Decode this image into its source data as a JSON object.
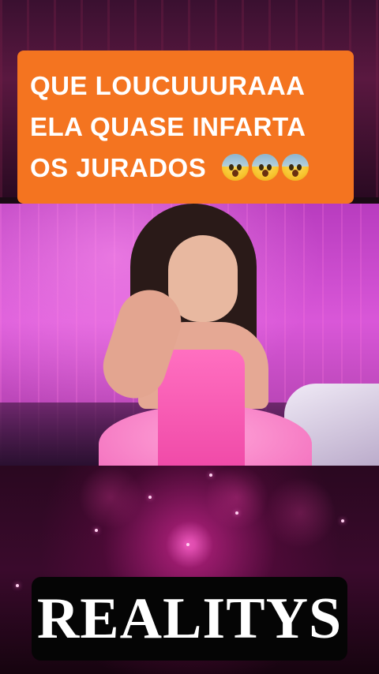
{
  "caption": {
    "lines": [
      "QUE LOUCUUURAAA",
      "ELA QUASE INFARTA",
      "OS JURADOS"
    ],
    "emoji": [
      "fearful-face-emoji",
      "fearful-face-emoji",
      "fearful-face-emoji"
    ],
    "background_color": "#f47420",
    "text_color": "#ffffff"
  },
  "brand": {
    "title": "REALITYS",
    "background_color": "#050505"
  },
  "colors": {
    "stage_pink": "#d957d8",
    "dress_pink": "#f04aa8"
  }
}
